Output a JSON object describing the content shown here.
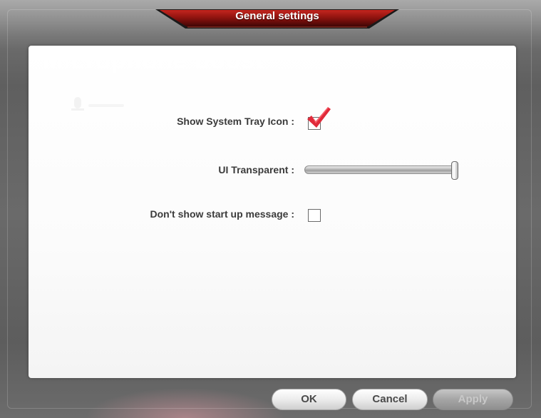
{
  "window": {
    "title": "General settings",
    "watermark": "Microphone boost"
  },
  "settings": {
    "show_tray_icon": {
      "label": "Show System Tray Icon :",
      "checked": true
    },
    "ui_transparent": {
      "label": "UI Transparent :",
      "value_fraction": 1.0
    },
    "startup_message": {
      "label": "Don't show start up message :",
      "checked": false
    }
  },
  "buttons": {
    "ok_label": "OK",
    "cancel_label": "Cancel",
    "apply_label": "Apply",
    "apply_enabled": false
  },
  "colors": {
    "title_bar": "#7a1010",
    "checkmark": "#e02a3a",
    "panel": "#ffffff"
  },
  "icons": {
    "checkmark": "red-checkmark-icon"
  }
}
